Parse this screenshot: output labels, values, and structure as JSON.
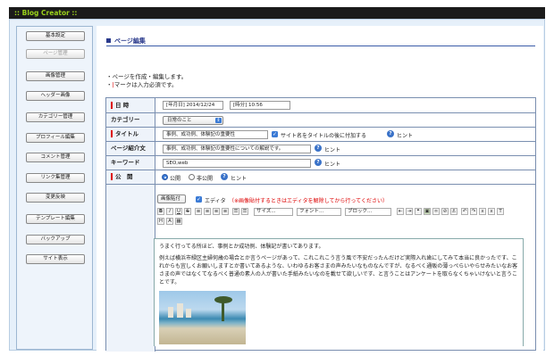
{
  "app": {
    "title": ":: Blog Creator ::"
  },
  "sidebar": {
    "items": [
      {
        "label": "基本設定",
        "disabled": false
      },
      {
        "label": "ページ管理",
        "disabled": true
      },
      {
        "label": "画像管理",
        "disabled": false
      },
      {
        "label": "ヘッダー画像",
        "disabled": false
      },
      {
        "label": "カテゴリー管理",
        "disabled": false
      },
      {
        "label": "プロフィール編集",
        "disabled": false
      },
      {
        "label": "コメント管理",
        "disabled": false
      },
      {
        "label": "リンク集管理",
        "disabled": false
      },
      {
        "label": "変更反映",
        "disabled": false
      },
      {
        "label": "テンプレート編集",
        "disabled": false
      },
      {
        "label": "バックアップ",
        "disabled": false
      },
      {
        "label": "サイト表示",
        "disabled": false
      }
    ]
  },
  "main": {
    "heading": "ページ編集",
    "notes": [
      "・ページを作成・編集します。",
      "マークは入力必須です。"
    ],
    "notes_prefix": "・",
    "form": {
      "date": {
        "label": "日 時",
        "date_label": "[年月日]",
        "date_value": "2014/12/24",
        "time_label": "[時分]",
        "time_value": "10:56"
      },
      "category": {
        "label": "カテゴリー",
        "selected": "日常のこと"
      },
      "title": {
        "label": "タイトル",
        "value": "事例、成功例、体験記の重要性",
        "checkbox_label": "サイト名をタイトルの後に付加する",
        "hint": "ヒント"
      },
      "intro": {
        "label": "ページ紹介文",
        "value": "事例、成功例、体験記の重要性についての解説です。",
        "hint": "ヒント"
      },
      "keyword": {
        "label": "キーワード",
        "value": "SEO,web",
        "hint": "ヒント"
      },
      "publish": {
        "label": "公　開",
        "option_public": "公開",
        "option_private": "非公開",
        "hint": "ヒント"
      },
      "editor": {
        "paste_button": "画像貼付",
        "editor_checkbox": "エディタ",
        "warning": "（※画像貼付するときはエディタを解除してから行ってください）",
        "toolbar": {
          "style_select": "サイズ...",
          "font_select": "フォント...",
          "block_select": "ブロック..."
        },
        "body": {
          "p1": "うまく行ってる所ほど、事例とか成功例、体験記が書いてあります。",
          "p2": "例えば横浜市緑区主婦何歳の場合とか言うページがあって、これこれこう言う風で不安だったんだけど実際入れ歯にしてみて本当に良かったです、これからも宜しくお願いしますとか書いてあるような、いわゆるお客さまの声みたいなものなんですが、なるべく通販の薄っぺらいやらせみたいなお客さまの声ではなくてなるべく普通の素人の人が書いた手紙みたいなのを載せて欲しいです、と言うことはアンケートを取らなくちゃいけないと言うことです。"
        }
      }
    }
  },
  "colors": {
    "accent_title": "#9ad21c",
    "heading": "#2a3a8c",
    "required": "#dd0000",
    "warning": "#dd0000",
    "control_blue": "#3b7bd6"
  }
}
